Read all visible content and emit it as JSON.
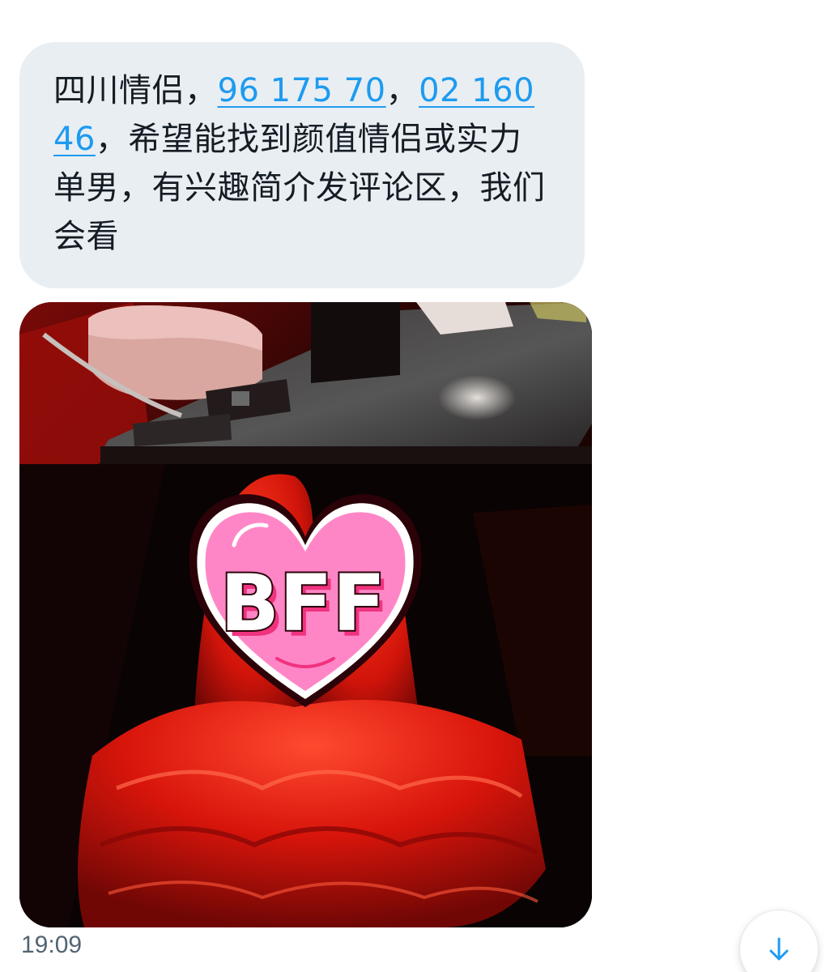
{
  "message": {
    "text_1": "四川情侣，",
    "link_1": "96 175 70",
    "text_2": "，",
    "link_2a": "02 160",
    "link_2b": "46",
    "text_3": "，希望能找到颜值情侣或实力单男，有兴趣简介发评论区，我们会看"
  },
  "photo": {
    "sticker_label": "BFF",
    "sticker_color": "#ff86c6",
    "sticker_text_color": "#f0337f"
  },
  "meta": {
    "timestamp": "19:09"
  },
  "controls": {
    "scroll_icon": "arrow-down-icon",
    "accent_color": "#1d9bf0"
  }
}
